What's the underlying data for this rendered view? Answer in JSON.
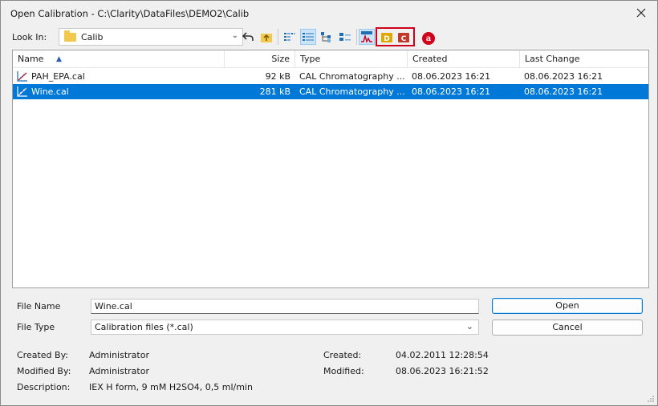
{
  "window": {
    "title": "Open Calibration - C:\\Clarity\\DataFiles\\DEMO2\\Calib",
    "close_icon": "close-icon"
  },
  "toolbar": {
    "look_in_label": "Look In:",
    "look_in_value": "Calib",
    "buttons": [
      {
        "name": "back-icon",
        "active": false
      },
      {
        "name": "up-folder-icon",
        "active": false
      },
      {
        "name": "list-view-icon",
        "active": false
      },
      {
        "name": "details-view-icon",
        "active": true
      },
      {
        "name": "tree-view-icon",
        "active": false
      },
      {
        "name": "thumbnail-view-icon",
        "active": false
      },
      {
        "name": "chromatogram-preview-icon",
        "active": true
      },
      {
        "name": "data-folder-icon",
        "active": false,
        "text": "D"
      },
      {
        "name": "calibration-folder-icon",
        "active": false,
        "text": "C"
      }
    ],
    "annotation_badge": "a"
  },
  "file_list": {
    "columns": {
      "name": "Name",
      "size": "Size",
      "type": "Type",
      "created": "Created",
      "last_change": "Last Change"
    },
    "sort_indicator": "▲",
    "rows": [
      {
        "name": "PAH_EPA.cal",
        "size": "92 kB",
        "type": "CAL Chromatography ...",
        "created": "08.06.2023 16:21",
        "last_change": "08.06.2023 16:21",
        "selected": false
      },
      {
        "name": "Wine.cal",
        "size": "281 kB",
        "type": "CAL Chromatography ...",
        "created": "08.06.2023 16:21",
        "last_change": "08.06.2023 16:21",
        "selected": true
      }
    ]
  },
  "form": {
    "file_name_label": "File Name",
    "file_name_value": "Wine.cal",
    "file_type_label": "File Type",
    "file_type_value": "Calibration files (*.cal)",
    "open_button": "Open",
    "cancel_button": "Cancel"
  },
  "info": {
    "created_by_label": "Created By:",
    "created_by_value": "Administrator",
    "modified_by_label": "Modified By:",
    "modified_by_value": "Administrator",
    "description_label": "Description:",
    "description_value": "IEX H form, 9 mM H2SO4, 0,5 ml/min",
    "created_label": "Created:",
    "created_value": "04.02.2011 12:28:54",
    "modified_label": "Modified:",
    "modified_value": "08.06.2023 16:21:52"
  },
  "colors": {
    "selection": "#0078d7",
    "annotation": "#d0021b",
    "folder": "#f2c94c"
  }
}
